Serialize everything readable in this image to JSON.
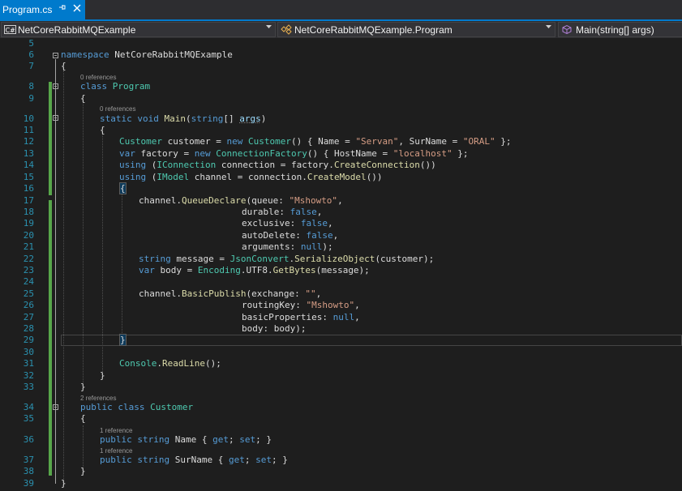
{
  "tab": {
    "title": "Program.cs",
    "pin_icon": "pin-icon",
    "close_icon": "close-icon",
    "accent": "#007acc"
  },
  "nav": {
    "project": "NetCoreRabbitMQExample",
    "type": "NetCoreRabbitMQExample.Program",
    "member": "Main(string[] args)"
  },
  "editor": {
    "line_numbers": [
      "5",
      "6",
      "7",
      "8",
      "9",
      "10",
      "11",
      "12",
      "13",
      "14",
      "15",
      "16",
      "17",
      "18",
      "19",
      "20",
      "21",
      "22",
      "23",
      "24",
      "25",
      "26",
      "27",
      "28",
      "29",
      "30",
      "31",
      "32",
      "33",
      "34",
      "35",
      "36",
      "37",
      "38",
      "39"
    ],
    "codelens": {
      "program": "0 references",
      "main": "0 references",
      "customer": "2 references",
      "name": "1 reference",
      "surname": "1 reference"
    },
    "colors": {
      "keyword": "#569cd6",
      "type": "#4ec9b0",
      "string": "#d69d85",
      "method": "#dcdcaa",
      "parameter": "#9cdcfe",
      "line_number": "#2b91af",
      "modified": "#57a64a"
    },
    "code": {
      "l6": [
        "namespace",
        " NetCoreRabbitMQExample"
      ],
      "l7": [
        "{"
      ],
      "l8": [
        "class",
        " ",
        "Program"
      ],
      "l9": [
        "{"
      ],
      "l10": [
        "static",
        " ",
        "void",
        " ",
        "Main",
        "(",
        "string",
        "[] ",
        "args",
        ")"
      ],
      "l11": [
        "{"
      ],
      "l12": [
        "Customer",
        " customer = ",
        "new",
        " ",
        "Customer",
        "() { Name = ",
        "\"Servan\"",
        ", SurName = ",
        "\"ORAL\"",
        " };"
      ],
      "l13": [
        "var",
        " factory = ",
        "new",
        " ",
        "ConnectionFactory",
        "() { HostName = ",
        "\"localhost\"",
        " };"
      ],
      "l14": [
        "using",
        " (",
        "IConnection",
        " connection = factory.",
        "CreateConnection",
        "())"
      ],
      "l15": [
        "using",
        " (",
        "IModel",
        " channel = connection.",
        "CreateModel",
        "())"
      ],
      "l16": [
        "{"
      ],
      "l17": [
        "channel.",
        "QueueDeclare",
        "(queue: ",
        "\"Mshowto\"",
        ","
      ],
      "l18": [
        "durable: ",
        "false",
        ","
      ],
      "l19": [
        "exclusive: ",
        "false",
        ","
      ],
      "l20": [
        "autoDelete: ",
        "false",
        ","
      ],
      "l21": [
        "arguments: ",
        "null",
        ");"
      ],
      "l22": [
        "string",
        " message = ",
        "JsonConvert",
        ".",
        "SerializeObject",
        "(customer);"
      ],
      "l23": [
        "var",
        " body = ",
        "Encoding",
        ".UTF8.",
        "GetBytes",
        "(message);"
      ],
      "l25": [
        "channel.",
        "BasicPublish",
        "(exchange: ",
        "\"\"",
        ","
      ],
      "l26": [
        "routingKey: ",
        "\"Mshowto\"",
        ","
      ],
      "l27": [
        "basicProperties: ",
        "null",
        ","
      ],
      "l28": [
        "body: body);"
      ],
      "l29": [
        "}"
      ],
      "l31": [
        "Console",
        ".",
        "ReadLine",
        "();"
      ],
      "l32": [
        "}"
      ],
      "l33": [
        "}"
      ],
      "l34": [
        "public",
        " ",
        "class",
        " ",
        "Customer"
      ],
      "l35": [
        "{"
      ],
      "l36": [
        "public",
        " ",
        "string",
        " Name { ",
        "get",
        "; ",
        "set",
        "; }"
      ],
      "l37": [
        "public",
        " ",
        "string",
        " SurName { ",
        "get",
        "; ",
        "set",
        "; }"
      ],
      "l38": [
        "}"
      ],
      "l39": [
        "}"
      ]
    }
  }
}
